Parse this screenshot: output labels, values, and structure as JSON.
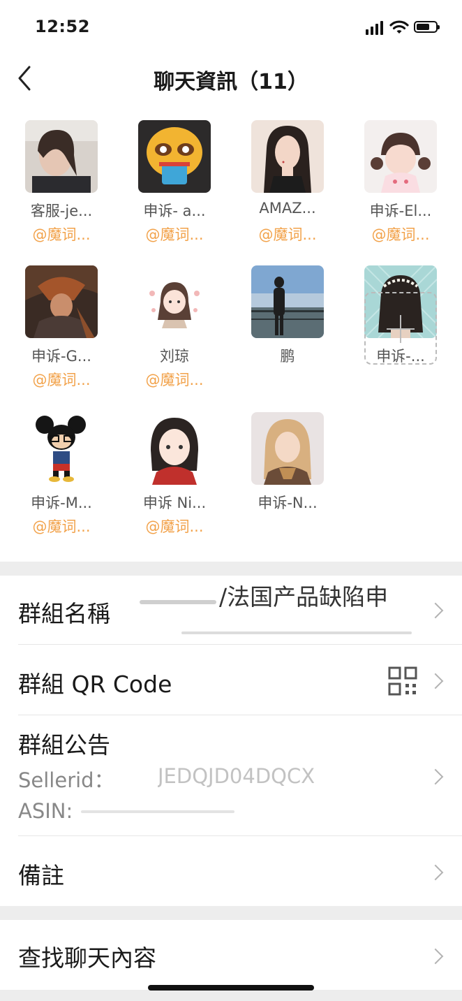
{
  "status_bar": {
    "time": "12:52"
  },
  "header": {
    "title": "聊天資訊（11）"
  },
  "members": [
    {
      "name": "客服-je...",
      "tag": "@魔词..."
    },
    {
      "name": "申诉- a...",
      "tag": "@魔词..."
    },
    {
      "name": "AMAZ...",
      "tag": "@魔词..."
    },
    {
      "name": "申诉-El...",
      "tag": "@魔词..."
    },
    {
      "name": "申诉-G...",
      "tag": "@魔词..."
    },
    {
      "name": "刘琼",
      "tag": "@魔词..."
    },
    {
      "name": "鹏",
      "tag": ""
    },
    {
      "name": "申诉-...",
      "tag": ""
    },
    {
      "name": "申诉-M...",
      "tag": "@魔词..."
    },
    {
      "name": "申诉 Ni...",
      "tag": "@魔词..."
    },
    {
      "name": "申诉-N...",
      "tag": ""
    }
  ],
  "settings": {
    "group_name_label": "群組名稱",
    "group_name_value": "/法国产品缺陷申",
    "group_qr_label": "群組 QR Code",
    "group_notice_label": "群組公告",
    "notice_line1": "Sellerid：",
    "notice_line1_fragment": "JEDQJD04DQCX",
    "notice_line2": "ASIN:",
    "remarks_label": "備註",
    "search_label": "查找聊天內容"
  },
  "icons": [
    "back-chevron-icon",
    "signal-icon",
    "wifi-icon",
    "battery-icon",
    "add-member-icon",
    "qr-code-icon",
    "chevron-right-icon"
  ]
}
